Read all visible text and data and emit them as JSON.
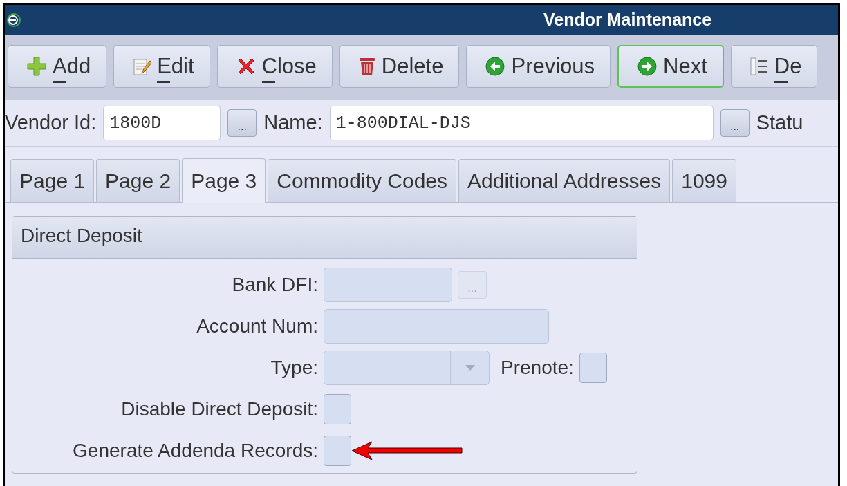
{
  "window": {
    "title": "Vendor Maintenance"
  },
  "toolbar": [
    {
      "kind": "add",
      "label": "Add",
      "accel": true,
      "focused": false
    },
    {
      "kind": "edit",
      "label": "Edit",
      "accel": true,
      "focused": false
    },
    {
      "kind": "close",
      "label": "Close",
      "accel": true,
      "focused": false
    },
    {
      "kind": "delete",
      "label": "Delete",
      "accel": false,
      "focused": false
    },
    {
      "kind": "previous",
      "label": "Previous",
      "accel": false,
      "focused": false
    },
    {
      "kind": "next",
      "label": "Next",
      "accel": false,
      "focused": true
    },
    {
      "kind": "list",
      "label": "De",
      "accel": true,
      "focused": false
    }
  ],
  "header_fields": [
    {
      "label": "Vendor Id:",
      "value": "1800D",
      "lookup_button": "..."
    },
    {
      "label": "Name:",
      "value": "1-800DIAL-DJS",
      "lookup_button": "..."
    },
    {
      "label": "Statu"
    }
  ],
  "tabs": [
    {
      "label": "Page 1",
      "selected": false
    },
    {
      "label": "Page 2",
      "selected": false
    },
    {
      "label": "Page 3",
      "selected": true
    },
    {
      "label": "Commodity Codes",
      "selected": false
    },
    {
      "label": "Additional Addresses",
      "selected": false
    },
    {
      "label": "1099",
      "selected": false
    }
  ],
  "group": {
    "title": "Direct Deposit",
    "rows": [
      {
        "kind": "lookup",
        "label": "Bank DFI:",
        "lookup_button": "...",
        "disabled": true
      },
      {
        "kind": "text",
        "label": "Account Num:",
        "disabled": true
      },
      {
        "kind": "select",
        "label": "Type:",
        "disabled": true,
        "extra": {
          "label": "Prenote:",
          "checked": false
        }
      },
      {
        "kind": "checkbox",
        "label": "Disable Direct Deposit:",
        "checked": false
      },
      {
        "kind": "checkbox",
        "label": "Generate Addenda Records:",
        "checked": false,
        "pointer": true
      }
    ]
  }
}
